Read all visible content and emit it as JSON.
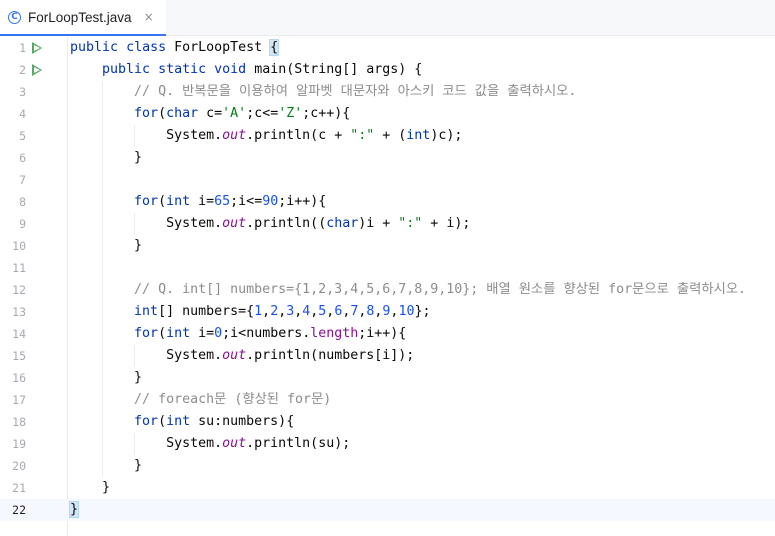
{
  "tab": {
    "filename": "ForLoopTest.java",
    "icon": "java-class-icon",
    "close": "×"
  },
  "colors": {
    "keyword": "#0033b3",
    "comment": "#8c8c8c",
    "string": "#067d17",
    "number": "#1750eb",
    "field": "#871094",
    "text": "#080808",
    "run_gutter": "#59a869",
    "accent": "#3574f0"
  },
  "editor": {
    "current_line": 22,
    "lines": [
      {
        "n": "1",
        "run": true,
        "code": "public class ForLoopTest {"
      },
      {
        "n": "2",
        "run": true,
        "code": "    public static void main(String[] args) {"
      },
      {
        "n": "3",
        "run": false,
        "code": "        // Q. 반복문을 이용하여 알파벳 대문자와 아스키 코드 값을 출력하시오."
      },
      {
        "n": "4",
        "run": false,
        "code": "        for(char c='A';c<='Z';c++){"
      },
      {
        "n": "5",
        "run": false,
        "code": "            System.out.println(c + \":\" + (int)c);"
      },
      {
        "n": "6",
        "run": false,
        "code": "        }"
      },
      {
        "n": "7",
        "run": false,
        "code": ""
      },
      {
        "n": "8",
        "run": false,
        "code": "        for(int i=65;i<=90;i++){"
      },
      {
        "n": "9",
        "run": false,
        "code": "            System.out.println((char)i + \":\" + i);"
      },
      {
        "n": "10",
        "run": false,
        "code": "        }"
      },
      {
        "n": "11",
        "run": false,
        "code": ""
      },
      {
        "n": "12",
        "run": false,
        "code": "        // Q. int[] numbers={1,2,3,4,5,6,7,8,9,10}; 배열 원소를 향상된 for문으로 출력하시오."
      },
      {
        "n": "13",
        "run": false,
        "code": "        int[] numbers={1,2,3,4,5,6,7,8,9,10};"
      },
      {
        "n": "14",
        "run": false,
        "code": "        for(int i=0;i<numbers.length;i++){"
      },
      {
        "n": "15",
        "run": false,
        "code": "            System.out.println(numbers[i]);"
      },
      {
        "n": "16",
        "run": false,
        "code": "        }"
      },
      {
        "n": "17",
        "run": false,
        "code": "        // foreach문 (향상된 for문)"
      },
      {
        "n": "18",
        "run": false,
        "code": "        for(int su:numbers){"
      },
      {
        "n": "19",
        "run": false,
        "code": "            System.out.println(su);"
      },
      {
        "n": "20",
        "run": false,
        "code": "        }"
      },
      {
        "n": "21",
        "run": false,
        "code": "    }"
      },
      {
        "n": "22",
        "run": false,
        "code": "}"
      }
    ]
  }
}
